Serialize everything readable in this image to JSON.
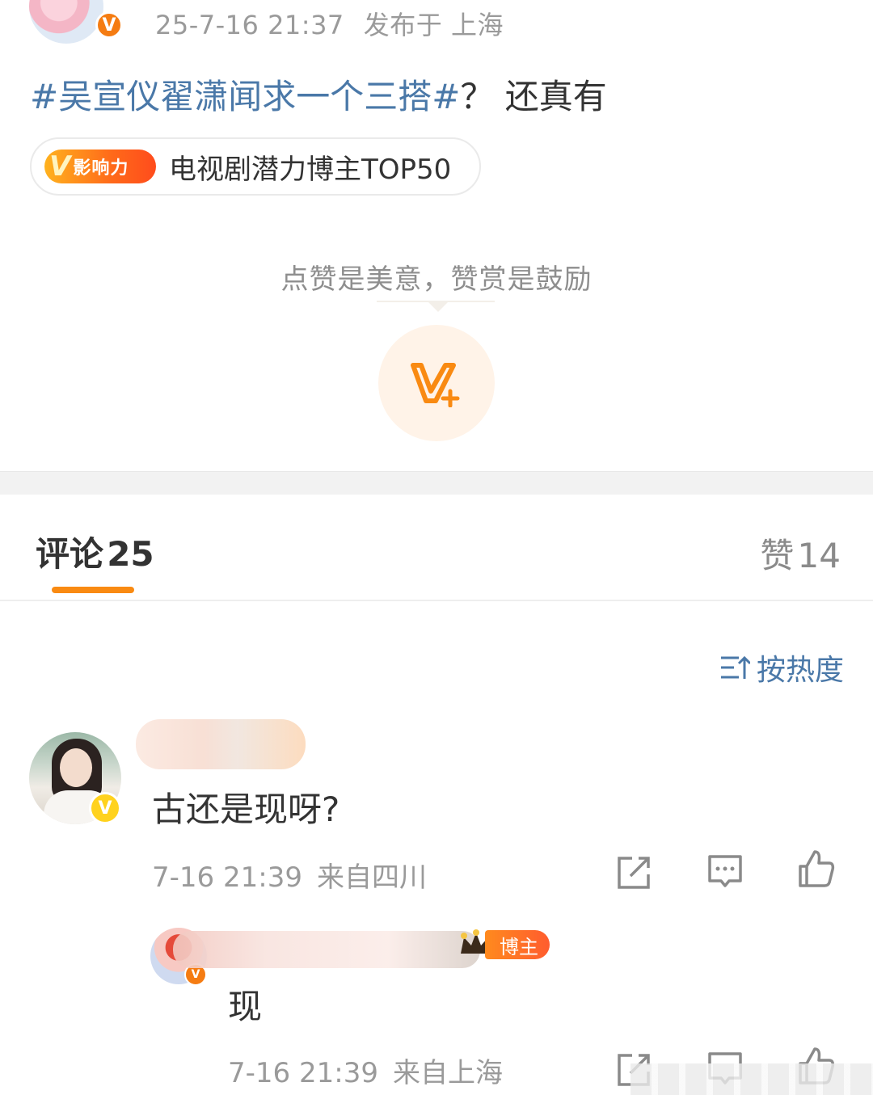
{
  "post": {
    "date": "25-7-16 21:37",
    "location": "发布于 上海",
    "hashtag": "#吴宣仪翟潇闻求一个三搭#",
    "text_rest": "？ 还真有",
    "influence_badge": "影响力",
    "influence_title": "电视剧潜力博主TOP50"
  },
  "reward": {
    "label": "点赞是美意，赞赏是鼓励"
  },
  "tabs": {
    "comments_label": "评论",
    "comments_count": "25",
    "likes_label": "赞",
    "likes_count": "14"
  },
  "sort": {
    "label": "按热度"
  },
  "comments": [
    {
      "text": "古还是现呀?",
      "date": "7-16 21:39",
      "location": "来自四川",
      "reply": {
        "role_badge": "博主",
        "text": "现",
        "date": "7-16 21:39",
        "location": "来自上海"
      }
    }
  ],
  "icons": {
    "share": "share-icon",
    "comment": "comment-icon",
    "like": "thumbs-up-icon",
    "sort": "sort-icon",
    "reward": "reward-icon",
    "verified": "verified-icon",
    "crown": "crown-icon"
  },
  "colors": {
    "accent_orange": "#f98a12",
    "link_blue": "#4a78a8",
    "muted_gray": "#9a9a9a"
  }
}
